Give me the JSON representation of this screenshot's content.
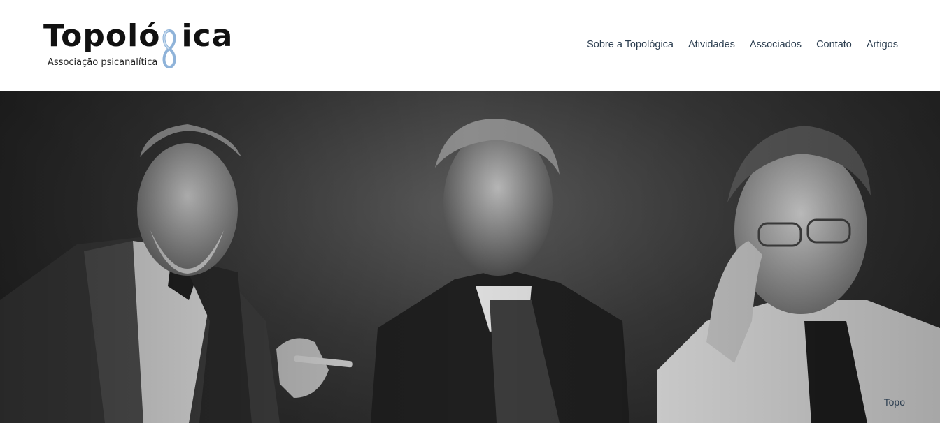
{
  "brand": {
    "name": "Topológica",
    "name_prefix": "Topoló",
    "name_suffix": "ica",
    "tagline": "Associação psicanalítica"
  },
  "nav": {
    "items": [
      {
        "label": "Sobre a Topológica"
      },
      {
        "label": "Atividades"
      },
      {
        "label": "Associados"
      },
      {
        "label": "Contato"
      },
      {
        "label": "Artigos"
      }
    ]
  },
  "hero": {
    "photo_style": "black-and-white",
    "portraits": [
      "portrait-left",
      "portrait-center",
      "portrait-right"
    ]
  },
  "back_to_top": {
    "label": "Topo"
  },
  "colors": {
    "nav_text": "#2c3e50",
    "logo_text": "#111111",
    "logo_mark": "#8fb3d9",
    "header_bg": "#ffffff"
  }
}
